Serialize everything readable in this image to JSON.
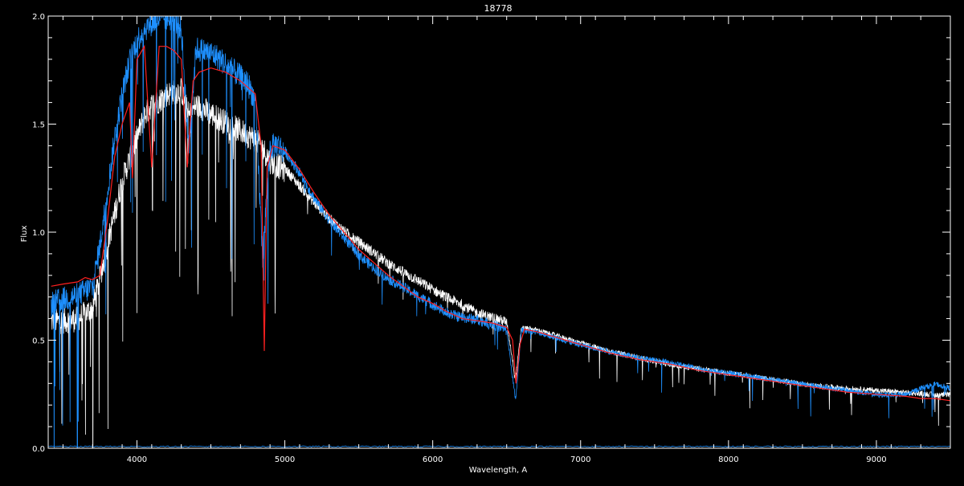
{
  "chart_data": {
    "type": "line",
    "title": "18778",
    "xlabel": "Wavelength, A",
    "ylabel": "Flux",
    "xlim": [
      3400,
      9500
    ],
    "ylim": [
      0.0,
      2.0
    ],
    "x_ticks": [
      4000,
      5000,
      6000,
      7000,
      8000,
      9000
    ],
    "x_tick_labels": [
      "4000",
      "5000",
      "6000",
      "7000",
      "8000",
      "9000"
    ],
    "y_ticks": [
      0.0,
      0.5,
      1.0,
      1.5,
      2.0
    ],
    "y_tick_labels": [
      "0.0",
      "0.5",
      "1.0",
      "1.5",
      "2.0"
    ],
    "background": "#000000",
    "axis_color": "#ffffff",
    "series": [
      {
        "color": "#ffffff",
        "style": "noisy",
        "x": [
          3420,
          3500,
          3600,
          3700,
          3750,
          3800,
          3850,
          3900,
          3950,
          4000,
          4050,
          4100,
          4150,
          4200,
          4250,
          4300,
          4350,
          4400,
          4450,
          4500,
          4550,
          4600,
          4650,
          4700,
          4750,
          4800,
          4850,
          4900,
          4950,
          5000,
          5100,
          5200,
          5300,
          5400,
          5500,
          5600,
          5700,
          5800,
          5900,
          6000,
          6100,
          6200,
          6300,
          6400,
          6500,
          6560,
          6600,
          6700,
          6800,
          6900,
          7000,
          7200,
          7400,
          7600,
          7800,
          8000,
          8200,
          8400,
          8600,
          8800,
          9000,
          9200,
          9400,
          9500
        ],
        "y": [
          0.6,
          0.6,
          0.61,
          0.66,
          0.8,
          0.95,
          1.1,
          1.25,
          1.35,
          1.45,
          1.55,
          1.6,
          1.62,
          1.65,
          1.66,
          1.67,
          1.55,
          1.6,
          1.58,
          1.56,
          1.54,
          1.52,
          1.5,
          1.48,
          1.46,
          1.44,
          1.4,
          1.34,
          1.32,
          1.3,
          1.22,
          1.14,
          1.07,
          1.01,
          0.96,
          0.91,
          0.86,
          0.82,
          0.78,
          0.74,
          0.7,
          0.67,
          0.63,
          0.61,
          0.59,
          0.32,
          0.56,
          0.55,
          0.53,
          0.51,
          0.49,
          0.45,
          0.42,
          0.39,
          0.37,
          0.35,
          0.33,
          0.31,
          0.29,
          0.28,
          0.27,
          0.26,
          0.25,
          0.25
        ]
      },
      {
        "color": "#1e90ff",
        "style": "noisy",
        "x": [
          3420,
          3500,
          3600,
          3700,
          3750,
          3800,
          3850,
          3900,
          3950,
          4000,
          4050,
          4100,
          4150,
          4200,
          4250,
          4300,
          4350,
          4400,
          4450,
          4500,
          4550,
          4600,
          4650,
          4700,
          4750,
          4800,
          4850,
          4900,
          4950,
          5000,
          5100,
          5200,
          5300,
          5400,
          5500,
          5600,
          5700,
          5800,
          5900,
          6000,
          6100,
          6200,
          6300,
          6400,
          6500,
          6560,
          6600,
          6700,
          6800,
          6900,
          7000,
          7200,
          7400,
          7600,
          7800,
          8000,
          8200,
          8400,
          8600,
          8800,
          9000,
          9200,
          9300,
          9400,
          9500
        ],
        "y": [
          0.68,
          0.7,
          0.72,
          0.76,
          0.95,
          1.2,
          1.45,
          1.65,
          1.8,
          1.9,
          1.95,
          1.98,
          2.0,
          2.0,
          2.0,
          1.95,
          1.4,
          1.86,
          1.85,
          1.84,
          1.82,
          1.79,
          1.76,
          1.73,
          1.7,
          1.62,
          0.9,
          1.4,
          1.42,
          1.38,
          1.28,
          1.16,
          1.06,
          0.98,
          0.9,
          0.84,
          0.79,
          0.75,
          0.71,
          0.67,
          0.63,
          0.61,
          0.6,
          0.58,
          0.55,
          0.22,
          0.55,
          0.54,
          0.52,
          0.5,
          0.48,
          0.45,
          0.42,
          0.4,
          0.37,
          0.35,
          0.33,
          0.31,
          0.29,
          0.27,
          0.25,
          0.25,
          0.28,
          0.3,
          0.28
        ]
      },
      {
        "color": "#ff2020",
        "style": "smooth",
        "x": [
          3420,
          3500,
          3600,
          3650,
          3700,
          3750,
          3800,
          3850,
          3900,
          3950,
          3970,
          4000,
          4050,
          4100,
          4150,
          4200,
          4250,
          4300,
          4340,
          4380,
          4420,
          4500,
          4600,
          4700,
          4800,
          4840,
          4861,
          4880,
          4920,
          5000,
          5100,
          5200,
          5300,
          5400,
          5500,
          5600,
          5700,
          5800,
          5900,
          6000,
          6100,
          6200,
          6300,
          6400,
          6500,
          6540,
          6563,
          6590,
          6620,
          6700,
          6800,
          6900,
          7000,
          7200,
          7400,
          7600,
          7800,
          8000,
          8200,
          8400,
          8600,
          8800,
          9000,
          9200,
          9300,
          9400,
          9500
        ],
        "y": [
          0.75,
          0.76,
          0.77,
          0.79,
          0.78,
          0.8,
          1.05,
          1.35,
          1.5,
          1.6,
          1.25,
          1.8,
          1.86,
          1.3,
          1.86,
          1.86,
          1.84,
          1.8,
          1.3,
          1.7,
          1.74,
          1.76,
          1.74,
          1.7,
          1.64,
          1.4,
          0.45,
          1.3,
          1.4,
          1.38,
          1.29,
          1.18,
          1.08,
          1.0,
          0.92,
          0.86,
          0.8,
          0.75,
          0.7,
          0.67,
          0.63,
          0.6,
          0.59,
          0.58,
          0.56,
          0.5,
          0.3,
          0.48,
          0.55,
          0.54,
          0.52,
          0.5,
          0.48,
          0.44,
          0.41,
          0.39,
          0.36,
          0.34,
          0.32,
          0.3,
          0.28,
          0.26,
          0.25,
          0.24,
          0.23,
          0.23,
          0.22
        ]
      }
    ]
  }
}
